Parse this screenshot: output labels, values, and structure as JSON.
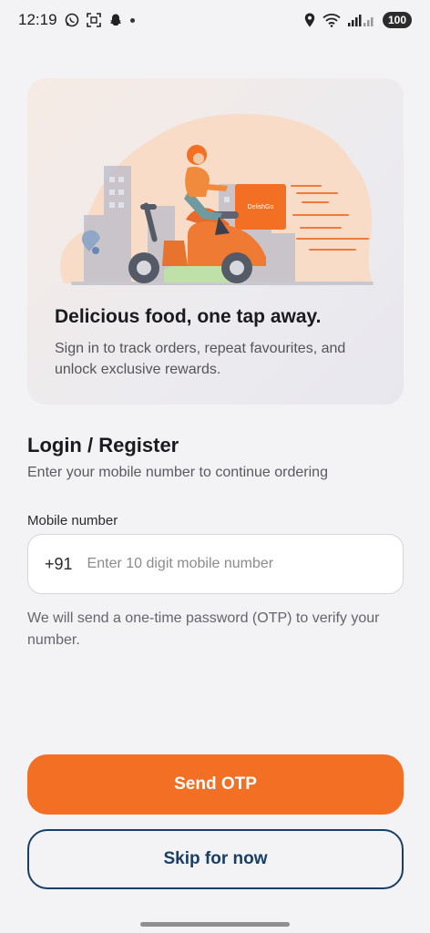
{
  "status_bar": {
    "time": "12:19",
    "battery": "100",
    "left_icons": [
      "whatsapp-icon",
      "screenshot-icon",
      "snapchat-icon",
      "notification-dot-icon"
    ],
    "right_icons": [
      "location-icon",
      "wifi-icon",
      "signal-icon"
    ]
  },
  "hero": {
    "brand_on_box": "DelishGo",
    "title": "Delicious food, one tap away.",
    "subtitle": "Sign in to track orders, repeat favourites, and unlock exclusive rewards."
  },
  "login": {
    "title": "Login / Register",
    "subtitle": "Enter your mobile number to continue ordering",
    "field_label": "Mobile number",
    "country_code": "+91",
    "placeholder": "Enter 10 digit mobile number",
    "value": "",
    "otp_note": "We will send a one-time password (OTP) to verify your number."
  },
  "actions": {
    "send_otp": "Send OTP",
    "skip": "Skip for now"
  },
  "colors": {
    "accent": "#f26f24",
    "secondary": "#183f66",
    "background": "#f3f2f5"
  }
}
